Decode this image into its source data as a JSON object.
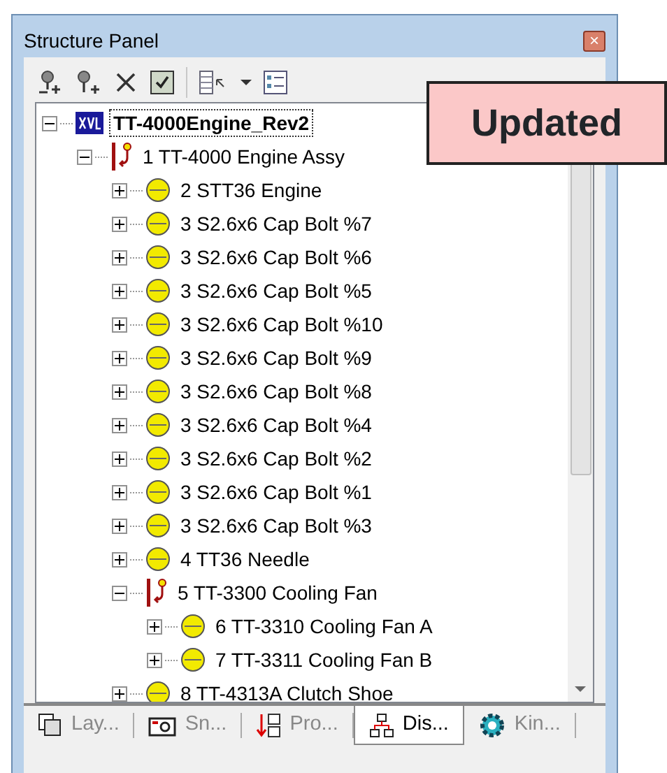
{
  "window": {
    "title": "Structure Panel",
    "close": "×"
  },
  "tree": [
    {
      "label": "TT-4000Engine_Rev2",
      "kind": "root",
      "expanded": true,
      "selected": true,
      "children": [
        {
          "label": "1 TT-4000 Engine Assy",
          "kind": "assembly",
          "expanded": true,
          "selected": false,
          "children": [
            {
              "label": "2 STT36 Engine",
              "kind": "part",
              "expanded": false,
              "selected": false
            },
            {
              "label": "3 S2.6x6 Cap Bolt %7",
              "kind": "part",
              "expanded": false,
              "selected": false
            },
            {
              "label": "3 S2.6x6 Cap Bolt %6",
              "kind": "part",
              "expanded": false,
              "selected": false
            },
            {
              "label": "3 S2.6x6 Cap Bolt %5",
              "kind": "part",
              "expanded": false,
              "selected": false
            },
            {
              "label": "3 S2.6x6 Cap Bolt %10",
              "kind": "part",
              "expanded": false,
              "selected": false
            },
            {
              "label": "3 S2.6x6 Cap Bolt %9",
              "kind": "part",
              "expanded": false,
              "selected": false
            },
            {
              "label": "3 S2.6x6 Cap Bolt %8",
              "kind": "part",
              "expanded": false,
              "selected": false
            },
            {
              "label": "3 S2.6x6 Cap Bolt %4",
              "kind": "part",
              "expanded": false,
              "selected": false
            },
            {
              "label": "3 S2.6x6 Cap Bolt %2",
              "kind": "part",
              "expanded": false,
              "selected": false
            },
            {
              "label": "3 S2.6x6 Cap Bolt %1",
              "kind": "part",
              "expanded": false,
              "selected": false
            },
            {
              "label": "3 S2.6x6 Cap Bolt %3",
              "kind": "part",
              "expanded": false,
              "selected": false
            },
            {
              "label": "4 TT36 Needle",
              "kind": "part",
              "expanded": false,
              "selected": false
            },
            {
              "label": "5 TT-3300 Cooling Fan",
              "kind": "assembly",
              "expanded": true,
              "selected": false,
              "children": [
                {
                  "label": "6 TT-3310 Cooling Fan A",
                  "kind": "part",
                  "expanded": false,
                  "selected": false
                },
                {
                  "label": "7 TT-3311 Cooling Fan B",
                  "kind": "part",
                  "expanded": false,
                  "selected": false
                }
              ]
            },
            {
              "label": "8 TT-4313A Clutch Shoe",
              "kind": "part",
              "expanded": false,
              "selected": false
            }
          ]
        }
      ]
    }
  ],
  "tabs": [
    {
      "label": "Lay...",
      "kind": "layers",
      "selected": false
    },
    {
      "label": "Sn...",
      "kind": "snapshot",
      "selected": false
    },
    {
      "label": "Pro...",
      "kind": "process",
      "selected": false
    },
    {
      "label": "Dis...",
      "kind": "display",
      "selected": true
    },
    {
      "label": "Kin...",
      "kind": "kinematics",
      "selected": false
    }
  ],
  "callout": {
    "text": "Updated"
  }
}
